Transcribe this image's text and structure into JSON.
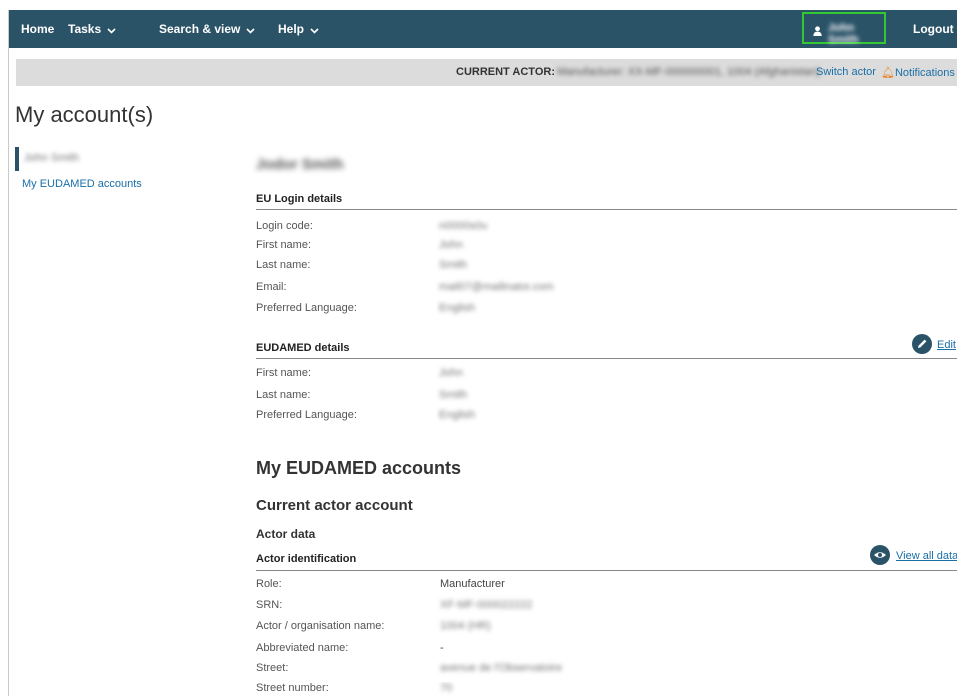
{
  "nav": {
    "home": "Home",
    "tasks": "Tasks",
    "search_view": "Search & view",
    "help": "Help",
    "user_name": "John Smith",
    "logout": "Logout"
  },
  "actor_bar": {
    "label": "CURRENT ACTOR:",
    "actor": "Manufacturer: XX-MF-000000001, 1004 (Afghanistan)",
    "switch": "Switch actor",
    "notifications": "Notifications"
  },
  "page_title": "My account(s)",
  "sidebar": {
    "user": "John Smith",
    "accounts_link": "My EUDAMED accounts"
  },
  "person_name": "Jodor Smith",
  "eu_login": {
    "title": "EU Login details",
    "rows": [
      {
        "label": "Login code:",
        "value": "n0000s0u"
      },
      {
        "label": "First name:",
        "value": "John"
      },
      {
        "label": "Last name:",
        "value": "Smith"
      },
      {
        "label": "Email:",
        "value": "mail07@mailinator.com"
      },
      {
        "label": "Preferred Language:",
        "value": "English"
      }
    ]
  },
  "eudamed": {
    "title": "EUDAMED details",
    "edit": "Edit",
    "rows": [
      {
        "label": "First name:",
        "value": "John"
      },
      {
        "label": "Last name:",
        "value": "Smith"
      },
      {
        "label": "Preferred Language:",
        "value": "English"
      }
    ]
  },
  "my_accounts_heading": "My EUDAMED accounts",
  "current_actor_heading": "Current actor account",
  "actor_data_heading": "Actor data",
  "actor_identification": {
    "title": "Actor identification",
    "view_all": "View all data",
    "rows": [
      {
        "label": "Role:",
        "value": "Manufacturer"
      },
      {
        "label": "SRN:",
        "value": "XF-MF-000022222"
      },
      {
        "label": "Actor / organisation name:",
        "value": "1004 (HR)"
      },
      {
        "label": "Abbreviated name:",
        "value": "-"
      },
      {
        "label": "Street:",
        "value": "avenue de l'Observatoire"
      },
      {
        "label": "Street number:",
        "value": "70"
      }
    ]
  },
  "colors": {
    "nav_bg": "#2b5368",
    "link": "#1a6fa8",
    "highlight": "#32c832"
  }
}
